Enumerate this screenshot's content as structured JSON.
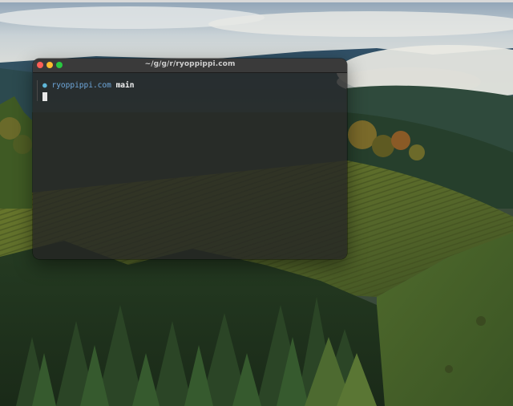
{
  "desktop": {
    "wallpaper": "vineyard-hills-forest-fog"
  },
  "terminal": {
    "title": "~/g/g/r/ryoppippi.com",
    "prompt": {
      "dot": "●",
      "host": "ryoppippi.com",
      "branch": "main"
    },
    "colors": {
      "close": "#ff5f57",
      "minimize": "#febc2e",
      "maximize": "#28c840",
      "host": "#6fa8dc"
    }
  }
}
